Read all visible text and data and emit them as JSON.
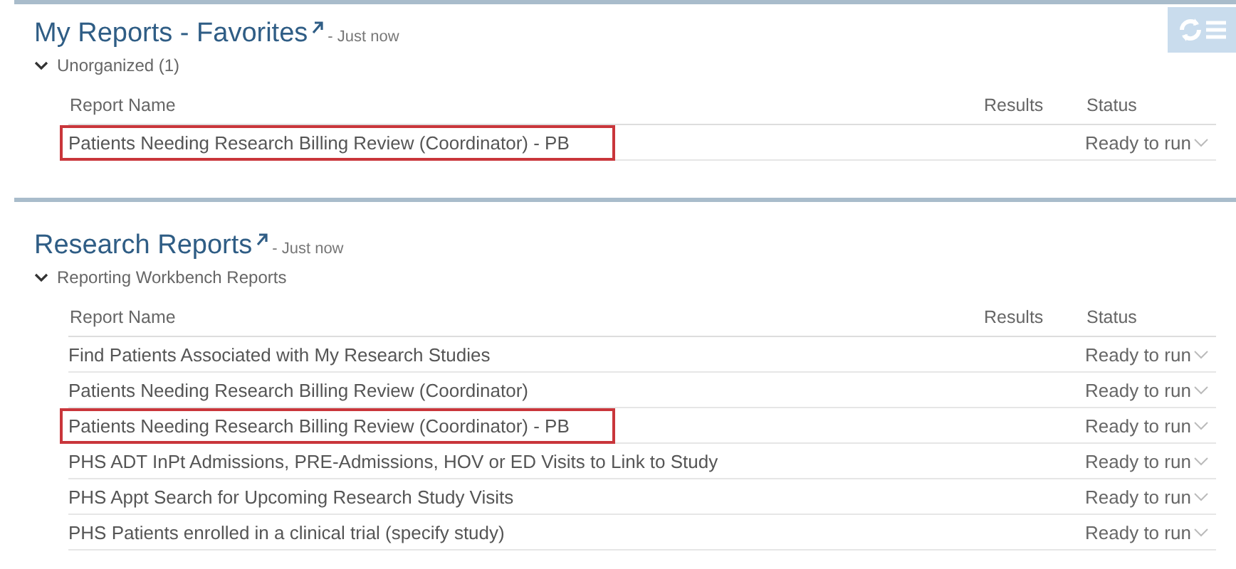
{
  "sections": [
    {
      "title": "My Reports - Favorites",
      "updated": "- Just now",
      "has_toolbar": true,
      "group": {
        "label": "Unorganized (1)",
        "expanded": true
      },
      "columns": [
        "Report Name",
        "Results",
        "Status"
      ],
      "rows": [
        {
          "name": "Patients Needing Research Billing Review (Coordinator) - PB",
          "status": "Ready to run",
          "highlighted": true
        }
      ]
    },
    {
      "title": "Research Reports",
      "updated": "- Just now",
      "has_toolbar": false,
      "group": {
        "label": "Reporting Workbench Reports",
        "expanded": true
      },
      "columns": [
        "Report Name",
        "Results",
        "Status"
      ],
      "rows": [
        {
          "name": "Find Patients Associated with My Research Studies",
          "status": "Ready to run",
          "highlighted": false
        },
        {
          "name": "Patients Needing Research Billing Review (Coordinator)",
          "status": "Ready to run",
          "highlighted": false
        },
        {
          "name": "Patients Needing Research Billing Review (Coordinator) - PB",
          "status": "Ready to run",
          "highlighted": true
        },
        {
          "name": "PHS ADT InPt Admissions, PRE-Admissions, HOV or ED Visits to Link to Study",
          "status": "Ready to run",
          "highlighted": false
        },
        {
          "name": "PHS Appt Search for Upcoming Research Study Visits",
          "status": "Ready to run",
          "highlighted": false
        },
        {
          "name": "PHS Patients enrolled in a clinical trial (specify study)",
          "status": "Ready to run",
          "highlighted": false
        }
      ]
    }
  ]
}
